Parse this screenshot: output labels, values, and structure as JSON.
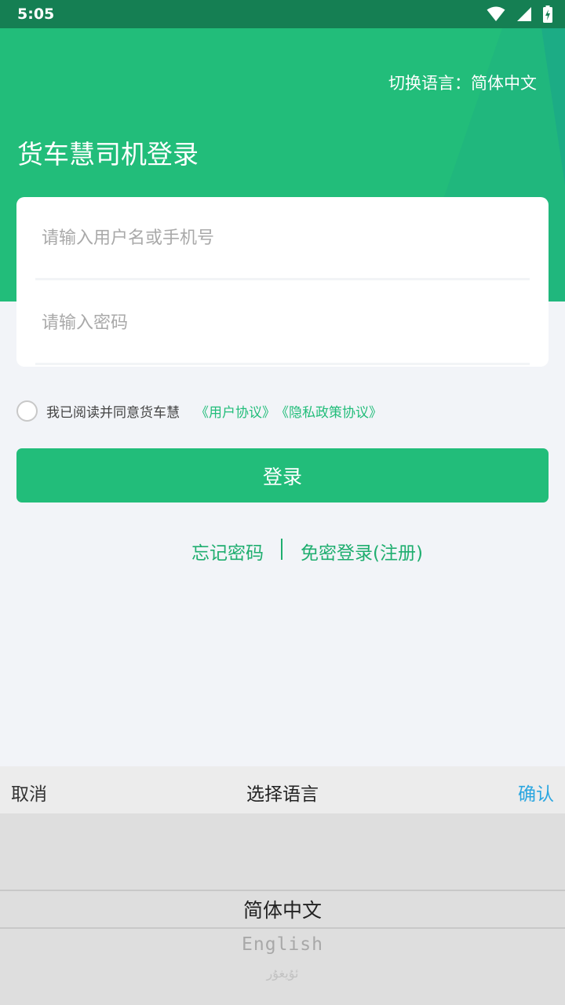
{
  "status_bar": {
    "time": "5:05"
  },
  "header": {
    "lang_switch_label": "切换语言：",
    "lang_switch_value": "简体中文",
    "title": "货车慧司机登录"
  },
  "login_form": {
    "username_placeholder": "请输入用户名或手机号",
    "password_placeholder": "请输入密码",
    "username_value": "",
    "password_value": ""
  },
  "agreement": {
    "text": "我已阅读并同意货车慧",
    "user_agreement_link": "《用户协议》",
    "privacy_link": "《隐私政策协议》",
    "checked": false
  },
  "login_button": {
    "label": "登录"
  },
  "links": {
    "forgot_password": "忘记密码",
    "passwordless_login": "免密登录(注册)"
  },
  "language_picker": {
    "cancel": "取消",
    "title": "选择语言",
    "confirm": "确认",
    "options": [
      "简体中文",
      "English",
      "ئۇيغۇر"
    ],
    "selected": "简体中文"
  },
  "colors": {
    "brand": "#22bd7a",
    "status_bar": "#157f53",
    "confirm": "#2aa6e0",
    "background": "#f2f4f8"
  }
}
